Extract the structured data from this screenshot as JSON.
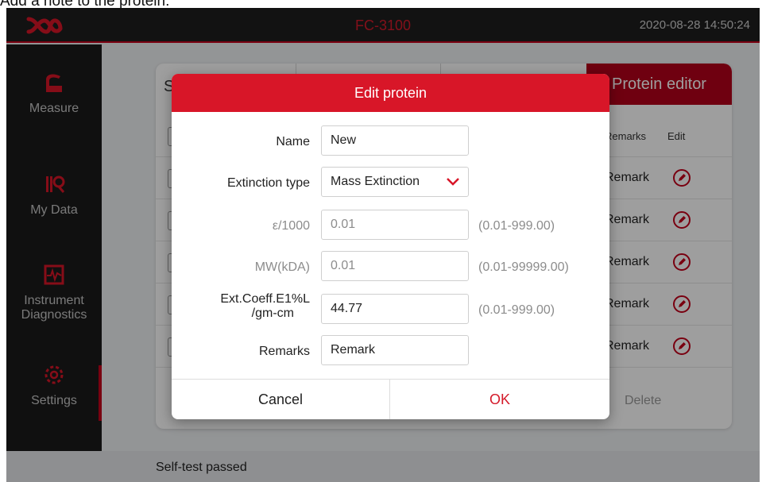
{
  "caption": "Add a note to the protein:",
  "header": {
    "model": "FC-3100",
    "datetime": "2020-08-28 14:50:24"
  },
  "sidebar": {
    "items": [
      {
        "label": "Measure",
        "icon": "measure-icon"
      },
      {
        "label": "My Data",
        "icon": "my-data-icon"
      },
      {
        "label": "Instrument Diagnostics",
        "icon": "diagnostics-icon"
      },
      {
        "label": "Settings",
        "icon": "settings-icon"
      }
    ],
    "active": "Settings"
  },
  "background": {
    "first_tab_initial": "S",
    "active_tab": "Protein editor",
    "columns": {
      "remarks": "Remarks",
      "edit": "Edit"
    },
    "rows": [
      "Remark",
      "Remark",
      "Remark",
      "Remark",
      "Remark"
    ],
    "delete_label": "Delete"
  },
  "status": {
    "text": "Self-test passed"
  },
  "dialog": {
    "title": "Edit protein",
    "fields": {
      "name": {
        "label": "Name",
        "value": "New"
      },
      "extinction_type": {
        "label": "Extinction type",
        "value": "Mass Extinction"
      },
      "epsilon": {
        "label": "ε/1000",
        "value": "0.01",
        "range": "(0.01-999.00)"
      },
      "mw": {
        "label": "MW(kDA)",
        "value": "0.01",
        "range": "(0.01-99999.00)"
      },
      "ext_coeff": {
        "label_line1": "Ext.Coeff.E1%L",
        "label_line2": "/gm-cm",
        "value": "44.77",
        "range": "(0.01-999.00)"
      },
      "remarks": {
        "label": "Remarks",
        "value": "Remark"
      }
    },
    "cancel_label": "Cancel",
    "ok_label": "OK"
  },
  "colors": {
    "accent_red": "#d81628",
    "dark_bg": "#1d1d1d",
    "brand_red": "#c4001a"
  }
}
